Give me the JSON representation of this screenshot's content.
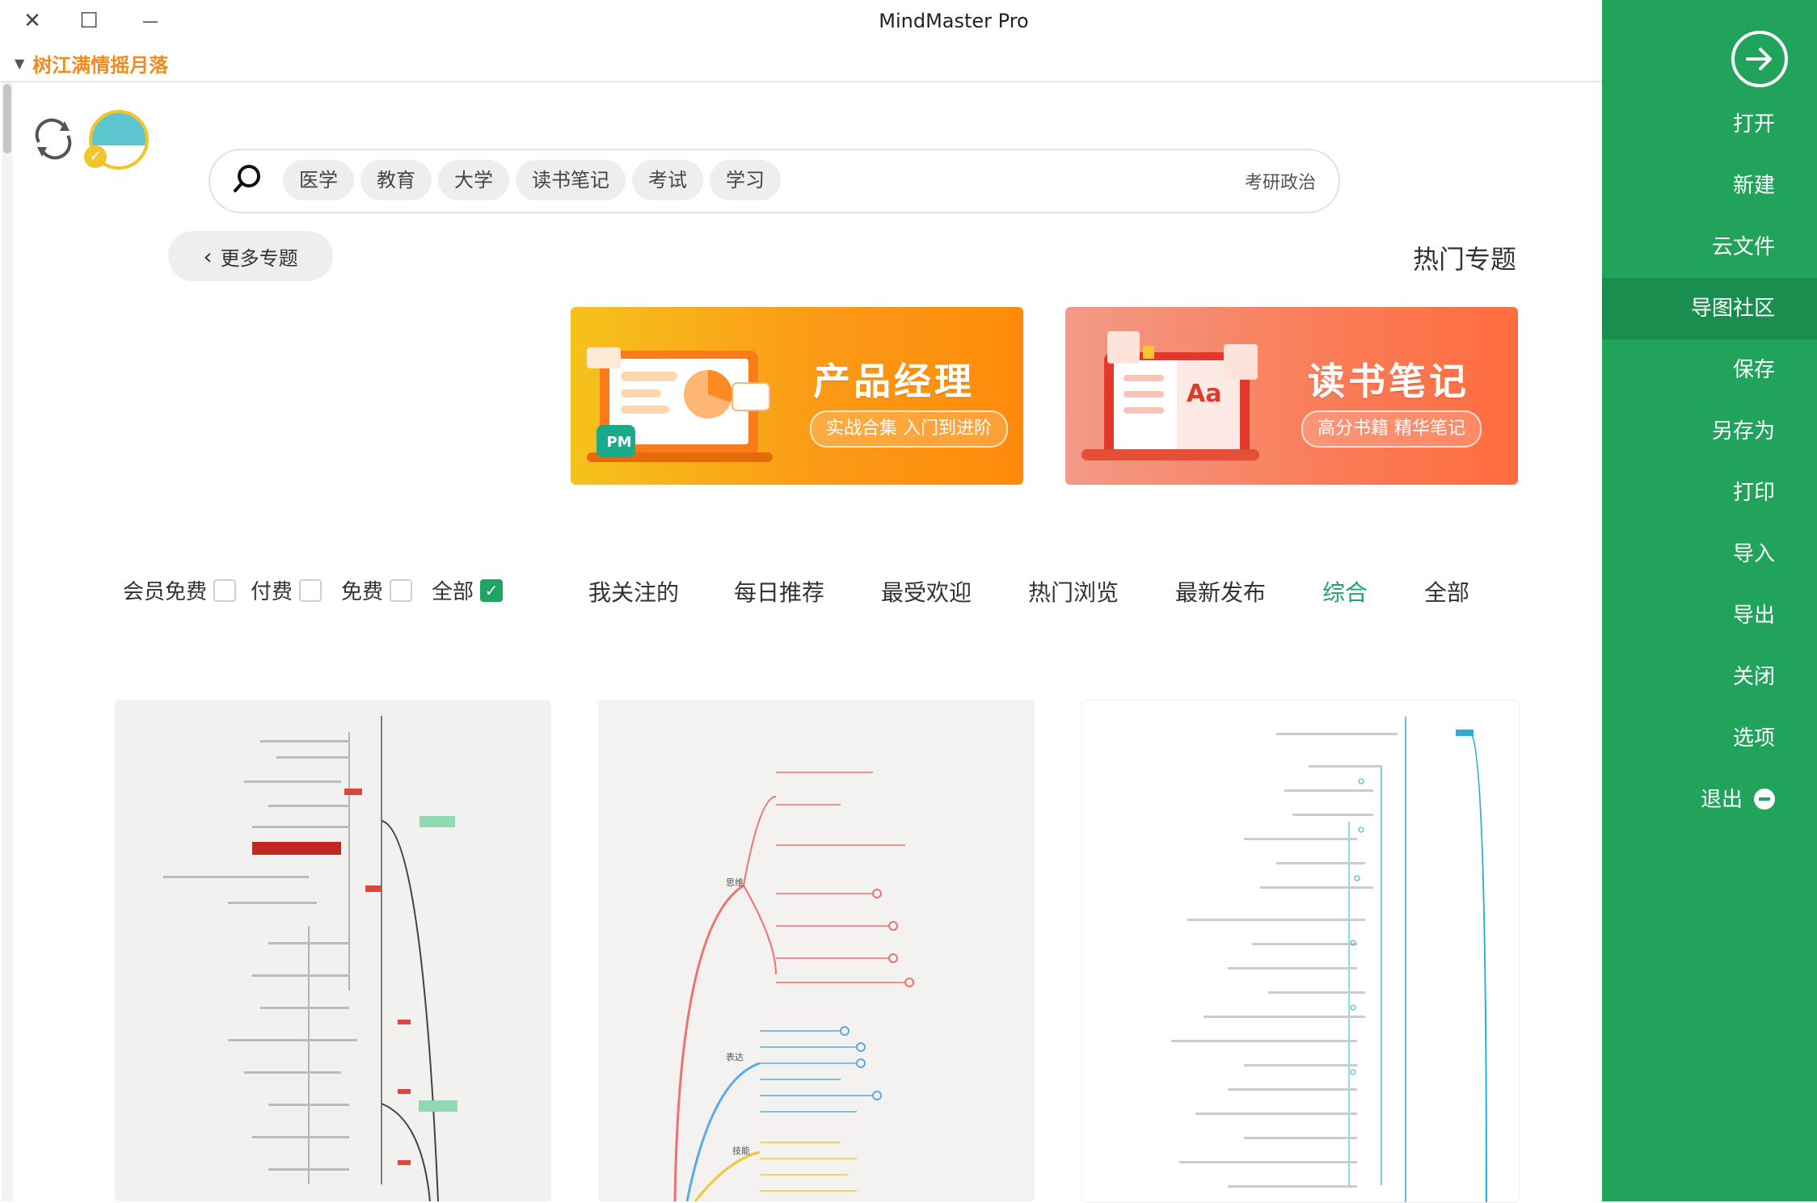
{
  "window": {
    "title": "MindMaster Pro",
    "close_glyph": "✕",
    "maximize_glyph": "☐",
    "minimize_glyph": "—"
  },
  "user": {
    "name": "树江满情摇月落"
  },
  "search": {
    "chips": [
      "医学",
      "教育",
      "大学",
      "读书笔记",
      "考试",
      "学习"
    ],
    "placeholder": "考研政治"
  },
  "hot_topics": {
    "more_label": "更多专题",
    "title": "热门专题"
  },
  "banners": [
    {
      "title": "产品经理",
      "subtitle": "实战合集 入门到进阶",
      "tag": "PM",
      "color_start": "#f6c21c",
      "color_end": "#ff8a0c"
    },
    {
      "title": "读书笔记",
      "subtitle": "高分书籍 精华笔记",
      "tag": "Aa",
      "color_start": "#f29a88",
      "color_end": "#ff6d3f"
    }
  ],
  "tabs": [
    {
      "label": "全部",
      "active": false
    },
    {
      "label": "综合",
      "active": true
    },
    {
      "label": "最新发布",
      "active": false
    },
    {
      "label": "热门浏览",
      "active": false
    },
    {
      "label": "最受欢迎",
      "active": false
    },
    {
      "label": "每日推荐",
      "active": false
    },
    {
      "label": "我关注的",
      "active": false
    }
  ],
  "filters": [
    {
      "label": "全部",
      "checked": true
    },
    {
      "label": "免费",
      "checked": false
    },
    {
      "label": "付费",
      "checked": false
    },
    {
      "label": "会员免费",
      "checked": false
    }
  ],
  "sidebar": {
    "items": [
      {
        "label": "打开",
        "active": false
      },
      {
        "label": "新建",
        "active": false
      },
      {
        "label": "云文件",
        "active": false
      },
      {
        "label": "导图社区",
        "active": true
      },
      {
        "label": "保存",
        "active": false
      },
      {
        "label": "另存为",
        "active": false
      },
      {
        "label": "打印",
        "active": false
      },
      {
        "label": "导入",
        "active": false
      },
      {
        "label": "导出",
        "active": false
      },
      {
        "label": "关闭",
        "active": false
      },
      {
        "label": "选项",
        "active": false
      }
    ],
    "exit_label": "退出",
    "accent": "#21a35c"
  },
  "cards": [
    {
      "name": "card-1",
      "icon": "mindmap-thumbnail"
    },
    {
      "name": "card-2",
      "icon": "mindmap-thumbnail"
    },
    {
      "name": "card-3",
      "icon": "mindmap-thumbnail"
    }
  ],
  "mindmap_labels": {
    "card2_branch_a": "思维",
    "card2_branch_b": "表达",
    "card2_branch_c": "技能"
  }
}
